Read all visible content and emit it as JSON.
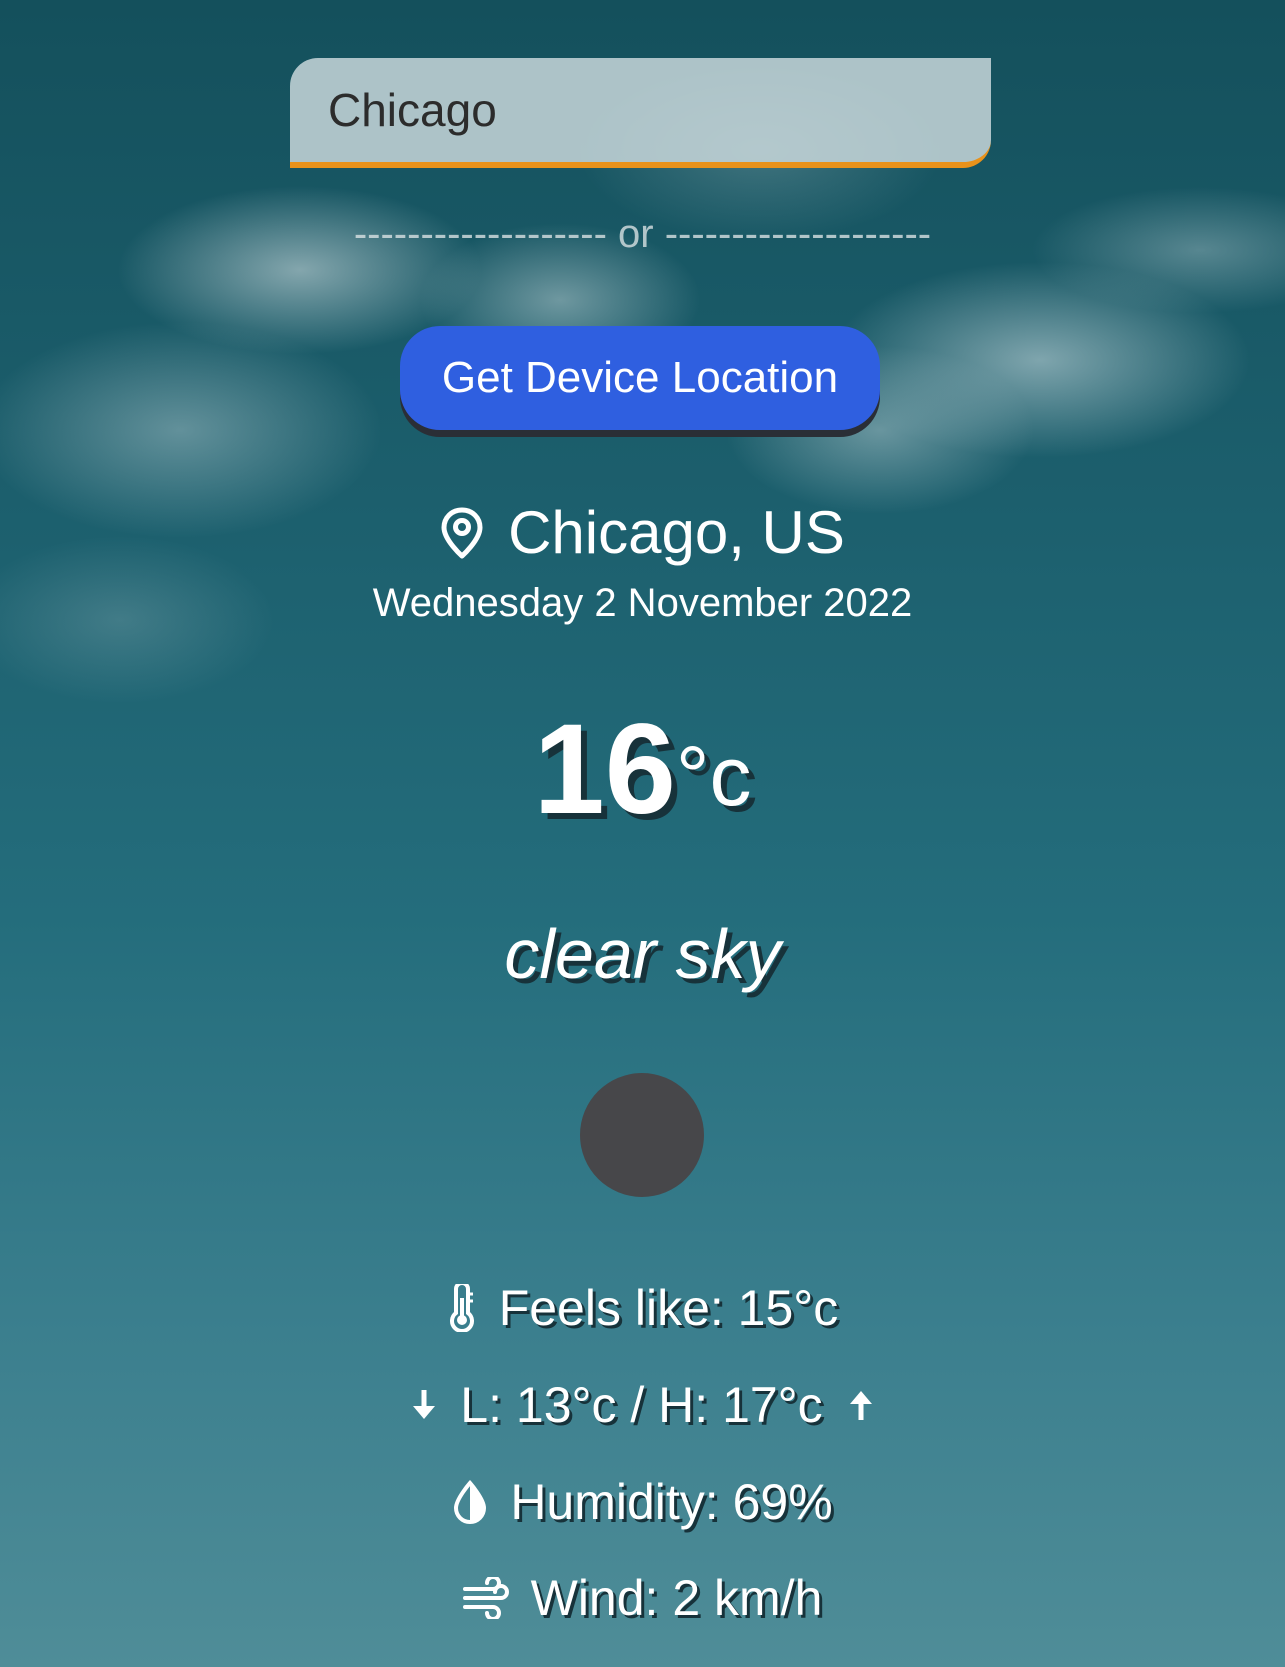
{
  "search": {
    "value": "Chicago"
  },
  "divider": {
    "text": "------------------- or --------------------"
  },
  "location_button": {
    "label": "Get Device Location"
  },
  "weather": {
    "city": "Chicago, US",
    "date": "Wednesday 2 November 2022",
    "temperature": "16",
    "unit": "°c",
    "description": "clear sky"
  },
  "details": {
    "feels_like": "Feels like: 15°c",
    "low_high": "L: 13°c / H: 17°c",
    "humidity": "Humidity: 69%",
    "wind": "Wind: 2 km/h"
  },
  "icons": {
    "location": "map-pin-icon",
    "feels_like": "thermometer-icon",
    "low": "arrow-down-icon",
    "high": "arrow-up-icon",
    "humidity": "droplet-icon",
    "wind": "wind-icon",
    "weather": "weather-condition-icon"
  },
  "colors": {
    "accent_underline": "#e8921b",
    "button": "#2f5fe0",
    "button_shadow": "#2a2e36",
    "icon_placeholder": "#47474a"
  }
}
